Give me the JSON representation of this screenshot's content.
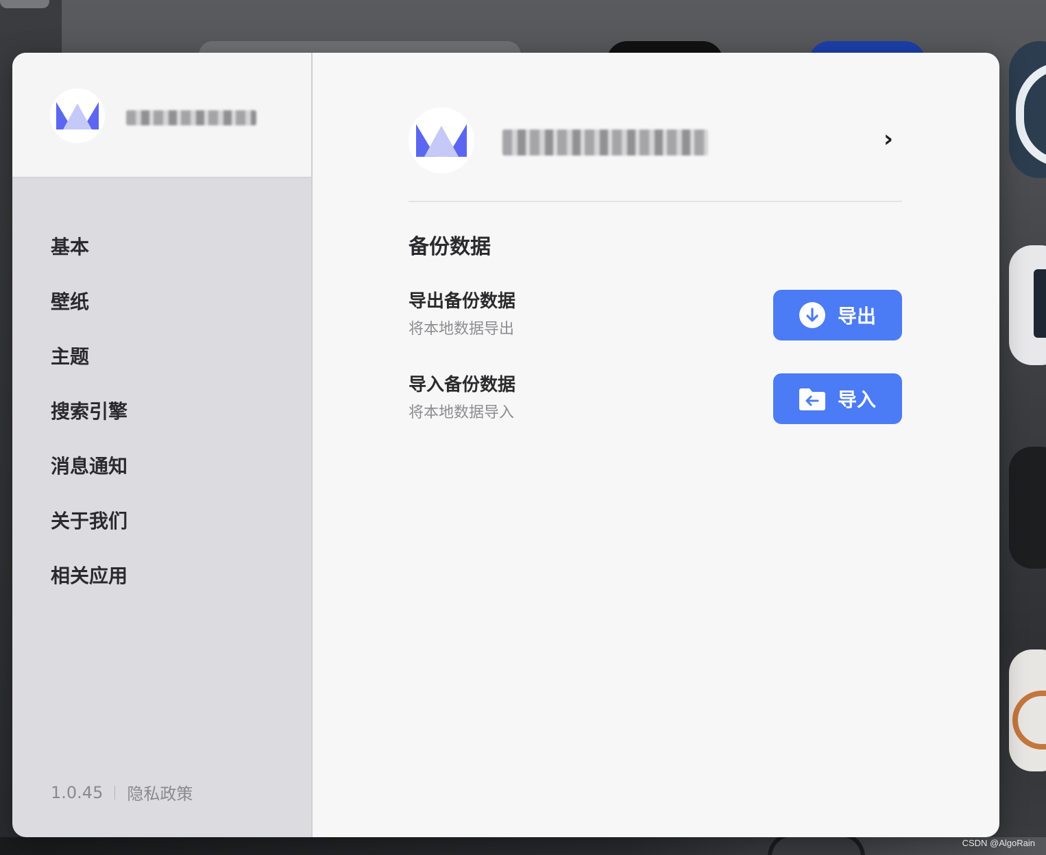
{
  "colors": {
    "accent": "#4b7bf5",
    "logo_primary": "#5b67f0",
    "logo_secondary": "#c5c9f7"
  },
  "sidebar": {
    "items": [
      {
        "label": "基本"
      },
      {
        "label": "壁纸"
      },
      {
        "label": "主题"
      },
      {
        "label": "搜索引擎"
      },
      {
        "label": "消息通知"
      },
      {
        "label": "关于我们"
      },
      {
        "label": "相关应用"
      }
    ],
    "version": "1.0.45",
    "privacy_label": "隐私政策"
  },
  "main": {
    "section_title": "备份数据",
    "export": {
      "title": "导出备份数据",
      "subtitle": "将本地数据导出",
      "button_label": "导出",
      "button_icon": "download-circle-icon"
    },
    "import": {
      "title": "导入备份数据",
      "subtitle": "将本地数据导入",
      "button_label": "导入",
      "button_icon": "folder-import-icon"
    }
  },
  "watermark": "CSDN @AlgoRain"
}
